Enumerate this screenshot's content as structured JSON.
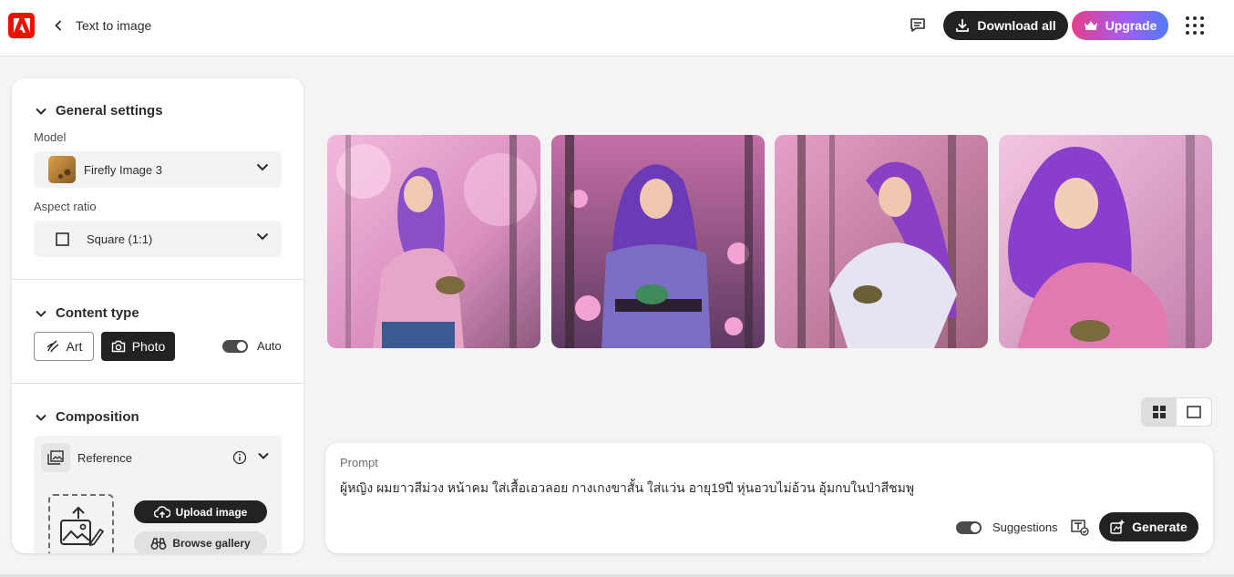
{
  "app": {
    "title": "Text to image"
  },
  "header": {
    "download_all_label": "Download all",
    "upgrade_label": "Upgrade",
    "icons": [
      "adobe-logo-icon",
      "chevron-left-icon",
      "feedback-icon",
      "download-icon",
      "crown-icon",
      "apps-grid-icon"
    ]
  },
  "sidebar": {
    "general_settings": {
      "title": "General settings",
      "model_label": "Model",
      "model_value": "Firefly Image 3",
      "aspect_label": "Aspect ratio",
      "aspect_value": "Square (1:1)"
    },
    "content_type": {
      "title": "Content type",
      "art_label": "Art",
      "photo_label": "Photo",
      "selected": "Photo",
      "auto_label": "Auto",
      "auto_on": true
    },
    "composition": {
      "title": "Composition",
      "reference_label": "Reference",
      "upload_label": "Upload image",
      "browse_label": "Browse gallery"
    }
  },
  "results": {
    "images": [
      {
        "name": "generated-image-1"
      },
      {
        "name": "generated-image-2"
      },
      {
        "name": "generated-image-3"
      },
      {
        "name": "generated-image-4"
      }
    ],
    "view_mode": "grid"
  },
  "prompt": {
    "label": "Prompt",
    "text": "ผู้หญิง ผมยาวสีม่วง หน้าคม ใส่เสื้อเอวลอย กางเกงขาสั้น ใส่แว่น อายุ19ปี หุ่นอวบไม่อ้วน อุ้มกบในป่าสีชมพู",
    "suggestions_label": "Suggestions",
    "suggestions_on": true,
    "generate_label": "Generate"
  },
  "colors": {
    "accent_dark": "#222222",
    "adobe_red": "#eb1000",
    "upgrade_gradient": [
      "#e63e8c",
      "#a45cf0",
      "#4f7cf7"
    ]
  }
}
